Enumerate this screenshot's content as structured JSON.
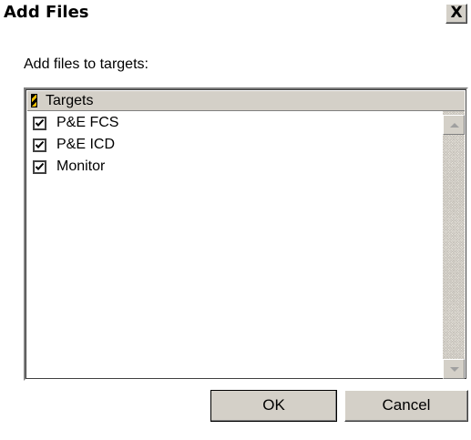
{
  "window": {
    "title": "Add Files",
    "close_glyph": "X"
  },
  "prompt": "Add files to targets:",
  "list": {
    "header_icon": "stripe-icon",
    "header_label": "Targets",
    "items": [
      {
        "label": "P&E FCS",
        "checked": true
      },
      {
        "label": "P&E ICD",
        "checked": true
      },
      {
        "label": "Monitor",
        "checked": true
      }
    ]
  },
  "buttons": {
    "ok": "OK",
    "cancel": "Cancel"
  }
}
